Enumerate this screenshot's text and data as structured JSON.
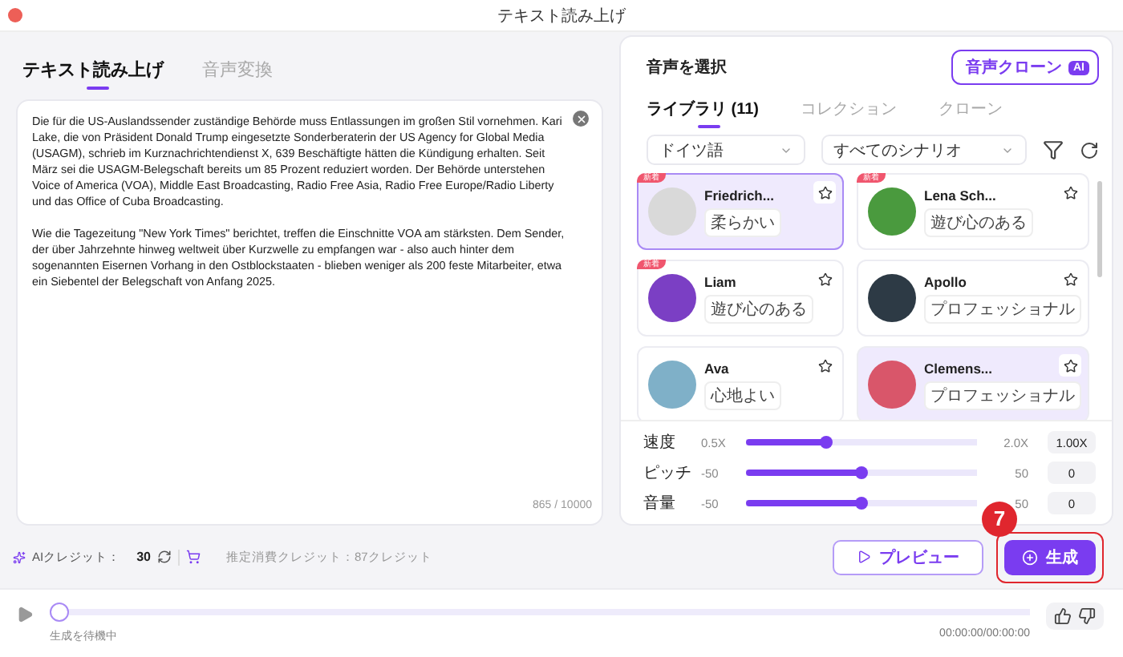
{
  "window": {
    "title": "テキスト読み上げ"
  },
  "mode_tabs": [
    {
      "label": "テキスト読み上げ",
      "selected": true
    },
    {
      "label": "音声変換",
      "selected": false
    }
  ],
  "editor": {
    "paragraphs": [
      "Die für die US-Auslandssender zuständige Behörde muss Entlassungen im großen Stil vornehmen. Kari Lake, die von Präsident Donald Trump eingesetzte Sonderberaterin der US Agency for Global Media (USAGM), schrieb im Kurznachrichtendienst X, 639 Beschäftigte hätten die Kündigung erhalten. Seit März sei die USAGM-Belegschaft bereits um 85 Prozent reduziert worden. Der Behörde unterstehen Voice of America (VOA), Middle East Broadcasting, Radio Free Asia, Radio Free Europe/Radio Liberty und das Office of Cuba Broadcasting.",
      "Wie die Tagezeitung \"New York Times\" berichtet, treffen die Einschnitte VOA am stärksten. Dem Sender, der über Jahrzehnte hinweg weltweit über Kurzwelle zu empfangen war - also auch hinter dem sogenannten Eisernen Vorhang in den Ostblockstaaten - blieben weniger als 200 feste Mitarbeiter, etwa ein Siebentel der Belegschaft von Anfang 2025."
    ],
    "counter": "865 / 10000"
  },
  "voice_panel": {
    "title": "音声を選択",
    "clone_button": "音声クローン",
    "clone_badge": "AI",
    "tabs": [
      {
        "label": "ライブラリ",
        "count": "(11)",
        "selected": true
      },
      {
        "label": "コレクション",
        "selected": false
      },
      {
        "label": "クローン",
        "selected": false
      }
    ],
    "filters": [
      {
        "value": "ドイツ語"
      },
      {
        "value": "すべてのシナリオ"
      }
    ],
    "voices": [
      {
        "name": "Friedrich...",
        "tag": "柔らかい",
        "badge": "新着",
        "selected": true,
        "hovered": false,
        "starred": false,
        "color": "#d9d9d9"
      },
      {
        "name": "Lena Sch...",
        "tag": "遊び心のある",
        "badge": "新着",
        "selected": false,
        "hovered": false,
        "starred": false,
        "color": "#4a9a3e"
      },
      {
        "name": "Liam",
        "tag": "遊び心のある",
        "badge": "新着",
        "selected": false,
        "hovered": false,
        "starred": false,
        "color": "#7b3fc4"
      },
      {
        "name": "Apollo",
        "tag": "プロフェッショナル",
        "selected": false,
        "hovered": false,
        "starred": false,
        "color": "#2d3a45"
      },
      {
        "name": "Ava",
        "tag": "心地よい",
        "selected": false,
        "hovered": false,
        "starred": false,
        "color": "#7fb0c8"
      },
      {
        "name": "Clemens...",
        "tag": "プロフェッショナル",
        "selected": false,
        "hovered": true,
        "starred": false,
        "color": "#d9566a"
      }
    ],
    "sliders": [
      {
        "label": "速度",
        "min": "0.5X",
        "max": "2.0X",
        "value": "1.00X",
        "level": 0.34
      },
      {
        "label": "ピッチ",
        "min": "-50",
        "max": "50",
        "value": "0",
        "level": 0.5
      },
      {
        "label": "音量",
        "min": "-50",
        "max": "50",
        "value": "0",
        "level": 0.5
      }
    ]
  },
  "credits": {
    "label": "AIクレジット：",
    "value": "30",
    "estimate": "推定消費クレジット：87クレジット"
  },
  "actions": {
    "preview": "プレビュー",
    "generate": "生成",
    "step_marker": "7"
  },
  "player": {
    "status": "生成を待機中",
    "time": "00:00:00/00:00:00",
    "level": 0
  }
}
